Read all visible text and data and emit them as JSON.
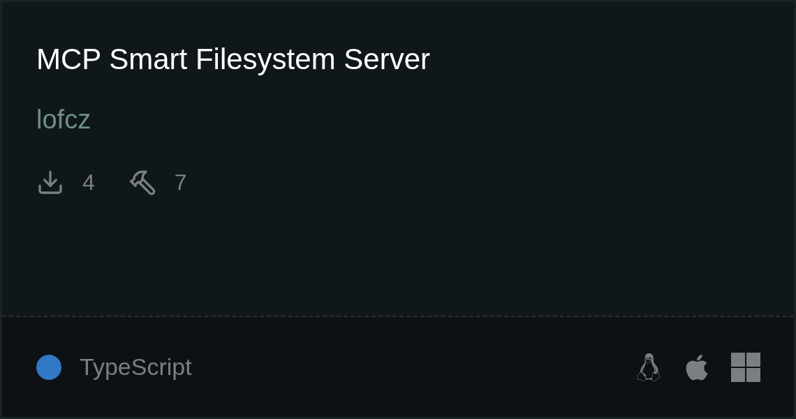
{
  "title": "MCP Smart Filesystem Server",
  "author": "lofcz",
  "stats": [
    {
      "kind": "downloads",
      "value": "4"
    },
    {
      "kind": "tools",
      "value": "7"
    }
  ],
  "language": {
    "name": "TypeScript",
    "color": "#3178c6"
  },
  "platforms": [
    {
      "kind": "linux"
    },
    {
      "kind": "apple"
    },
    {
      "kind": "windows"
    }
  ]
}
